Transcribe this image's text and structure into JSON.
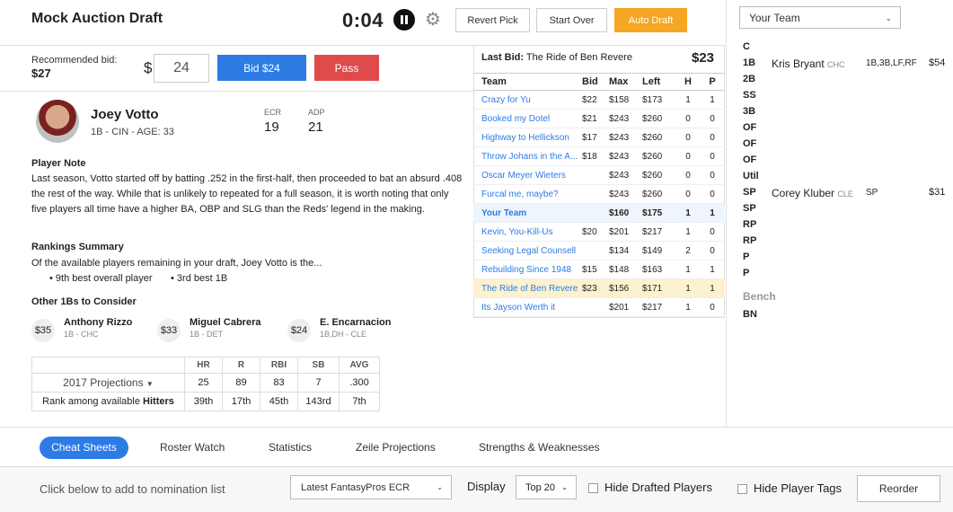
{
  "header": {
    "title": "Mock Auction Draft",
    "timer": "0:04",
    "revert_label": "Revert Pick",
    "start_over_label": "Start Over",
    "auto_draft_label": "Auto Draft",
    "accent_color": "#f5a623"
  },
  "team_select": {
    "value": "Your Team"
  },
  "bid": {
    "recommended_label": "Recommended bid:",
    "recommended_value": "$27",
    "currency": "$",
    "input_value": "24",
    "bid_button": "Bid $24",
    "pass_button": "Pass",
    "bid_color": "#2d7be5",
    "pass_color": "#e04a4a"
  },
  "player": {
    "name": "Joey Votto",
    "info": "1B - CIN - AGE: 33",
    "ecr_label": "ECR",
    "ecr_value": "19",
    "adp_label": "ADP",
    "adp_value": "21",
    "note_heading": "Player Note",
    "note_text": "Last season, Votto started off by batting .252 in the first-half, then proceeded to bat an absurd .408 the rest of the way. While that is unlikely to repeated for a full season, it is worth noting that only five players all time have a higher BA, OBP and SLG than the Reds' legend in the making.",
    "rankings_heading": "Rankings Summary",
    "rankings_text": "Of the available players remaining in your draft, Joey Votto is the...",
    "rank_bullets": [
      "• 9th best overall player",
      "• 3rd best 1B"
    ],
    "other_heading": "Other 1Bs to Consider",
    "others": [
      {
        "price": "$35",
        "name": "Anthony Rizzo",
        "sub": "1B - CHC"
      },
      {
        "price": "$33",
        "name": "Miguel Cabrera",
        "sub": "1B - DET"
      },
      {
        "price": "$24",
        "name": "E. Encarnacion",
        "sub": "1B,DH - CLE"
      }
    ]
  },
  "projections": {
    "label": "2017 Projections",
    "columns": [
      "HR",
      "R",
      "RBI",
      "SB",
      "AVG"
    ],
    "values": [
      "25",
      "89",
      "83",
      "7",
      ".300"
    ],
    "rank_label": "Rank among available",
    "rank_label_bold": "Hitters",
    "ranks": [
      "39th",
      "17th",
      "45th",
      "143rd",
      "7th"
    ]
  },
  "bids_panel": {
    "last_bid_label": "Last Bid:",
    "last_bid_team": "The Ride of Ben Revere",
    "last_bid_amount": "$23",
    "columns": [
      "Team",
      "Bid",
      "Max",
      "Left",
      "H",
      "P"
    ],
    "rows": [
      {
        "team": "Crazy for Yu",
        "bid": "$22",
        "max": "$158",
        "left": "$173",
        "h": "1",
        "p": "1"
      },
      {
        "team": "Booked my Dotel",
        "bid": "$21",
        "max": "$243",
        "left": "$260",
        "h": "0",
        "p": "0"
      },
      {
        "team": "Highway to Hellickson",
        "bid": "$17",
        "max": "$243",
        "left": "$260",
        "h": "0",
        "p": "0"
      },
      {
        "team": "Throw Johans in the A...",
        "bid": "$18",
        "max": "$243",
        "left": "$260",
        "h": "0",
        "p": "0"
      },
      {
        "team": "Oscar Meyer Wieters",
        "bid": "",
        "max": "$243",
        "left": "$260",
        "h": "0",
        "p": "0"
      },
      {
        "team": "Furcal me, maybe?",
        "bid": "",
        "max": "$243",
        "left": "$260",
        "h": "0",
        "p": "0"
      },
      {
        "team": "Your Team",
        "bid": "",
        "max": "$160",
        "left": "$175",
        "h": "1",
        "p": "1"
      },
      {
        "team": "Kevin, You-Kill-Us",
        "bid": "$20",
        "max": "$201",
        "left": "$217",
        "h": "1",
        "p": "0"
      },
      {
        "team": "Seeking Legal Counsell",
        "bid": "",
        "max": "$134",
        "left": "$149",
        "h": "2",
        "p": "0"
      },
      {
        "team": "Rebuilding Since 1948",
        "bid": "$15",
        "max": "$148",
        "left": "$163",
        "h": "1",
        "p": "1"
      },
      {
        "team": "The Ride of Ben Revere",
        "bid": "$23",
        "max": "$156",
        "left": "$171",
        "h": "1",
        "p": "1"
      },
      {
        "team": "Its Jayson Werth it",
        "bid": "",
        "max": "$201",
        "left": "$217",
        "h": "1",
        "p": "0"
      }
    ]
  },
  "roster": {
    "slots": [
      {
        "pos": "C",
        "player": "",
        "team": "",
        "elig": "",
        "price": ""
      },
      {
        "pos": "1B",
        "player": "Kris Bryant",
        "team": "CHC",
        "elig": "1B,3B,LF,RF",
        "price": "$54"
      },
      {
        "pos": "2B",
        "player": "",
        "team": "",
        "elig": "",
        "price": ""
      },
      {
        "pos": "SS",
        "player": "",
        "team": "",
        "elig": "",
        "price": ""
      },
      {
        "pos": "3B",
        "player": "",
        "team": "",
        "elig": "",
        "price": ""
      },
      {
        "pos": "OF",
        "player": "",
        "team": "",
        "elig": "",
        "price": ""
      },
      {
        "pos": "OF",
        "player": "",
        "team": "",
        "elig": "",
        "price": ""
      },
      {
        "pos": "OF",
        "player": "",
        "team": "",
        "elig": "",
        "price": ""
      },
      {
        "pos": "Util",
        "player": "",
        "team": "",
        "elig": "",
        "price": ""
      },
      {
        "pos": "SP",
        "player": "Corey Kluber",
        "team": "CLE",
        "elig": "SP",
        "price": "$31"
      },
      {
        "pos": "SP",
        "player": "",
        "team": "",
        "elig": "",
        "price": ""
      },
      {
        "pos": "RP",
        "player": "",
        "team": "",
        "elig": "",
        "price": ""
      },
      {
        "pos": "RP",
        "player": "",
        "team": "",
        "elig": "",
        "price": ""
      },
      {
        "pos": "P",
        "player": "",
        "team": "",
        "elig": "",
        "price": ""
      },
      {
        "pos": "P",
        "player": "",
        "team": "",
        "elig": "",
        "price": ""
      }
    ],
    "bench_heading": "Bench",
    "bench_slot": "BN"
  },
  "tabs": [
    "Cheat Sheets",
    "Roster Watch",
    "Statistics",
    "Zeile Projections",
    "Strengths & Weaknesses"
  ],
  "footer": {
    "click_label": "Click below to add to nomination list",
    "ecr_select": "Latest FantasyPros ECR",
    "display_label": "Display",
    "top_select": "Top 20",
    "hide_drafted": "Hide Drafted Players",
    "hide_tags": "Hide Player Tags",
    "reorder": "Reorder"
  }
}
